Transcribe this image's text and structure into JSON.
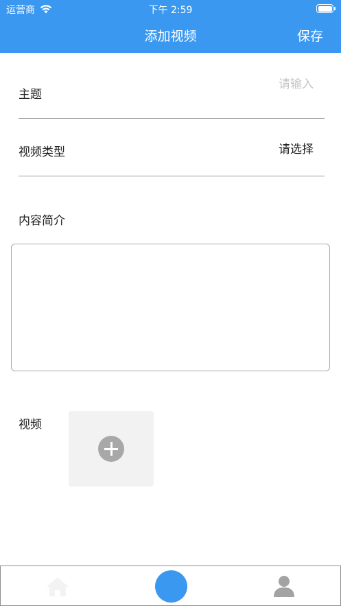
{
  "status_bar": {
    "carrier": "运营商",
    "time": "下午 2:59"
  },
  "header": {
    "title": "添加视频",
    "save_label": "保存"
  },
  "form": {
    "topic_label": "主题",
    "topic_placeholder": "请输入",
    "type_label": "视频类型",
    "type_value": "请选择",
    "summary_label": "内容简介",
    "video_label": "视频"
  },
  "colors": {
    "accent": "#3a98f0",
    "placeholder": "#c4c4c4",
    "divider": "#9c9c9c"
  },
  "tab_bar": {
    "items": [
      "home-icon",
      "center-button",
      "profile-icon"
    ]
  }
}
